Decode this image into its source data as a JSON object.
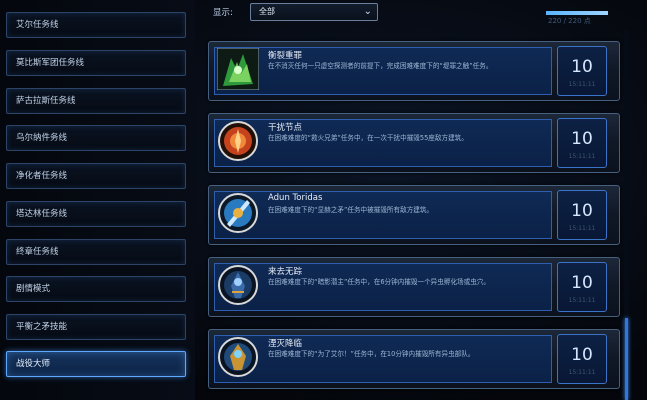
{
  "sidebar": {
    "items": [
      {
        "label": "艾尔任务线",
        "active": false
      },
      {
        "label": "莫比斯军团任务线",
        "active": false
      },
      {
        "label": "萨古拉斯任务线",
        "active": false
      },
      {
        "label": "乌尔纳件务线",
        "active": false
      },
      {
        "label": "净化者任务线",
        "active": false
      },
      {
        "label": "塔达林任务线",
        "active": false
      },
      {
        "label": "终章任务线",
        "active": false
      },
      {
        "label": "剧情模式",
        "active": false
      },
      {
        "label": "平衡之矛技能",
        "active": false
      },
      {
        "label": "战役大师",
        "active": true
      }
    ]
  },
  "filter": {
    "label": "显示:",
    "selected": "全部"
  },
  "progress": {
    "text": "220 / 220 点",
    "fraction": 1.0
  },
  "achievements": [
    {
      "title": "衡裂重罪",
      "desc": "在不消灭任何一只虚空探测者的前提下，完成困难难度下的“堤罪之触”任务。",
      "points": "10",
      "date": "15:11:11",
      "icon": "green-crystal-icon"
    },
    {
      "title": "干扰节点",
      "desc": "在困难难度的“救火兄弟”任务中，在一次干扰中摧毁55座敌方建筑。",
      "points": "10",
      "date": "15:11:11",
      "icon": "red-sigil-icon"
    },
    {
      "title": "Adun Toridas",
      "desc": "在困难难度下的“显赫之矛”任务中被摧毁所有敌方建筑。",
      "points": "10",
      "date": "15:11:11",
      "icon": "blue-blade-icon"
    },
    {
      "title": "来去无踪",
      "desc": "在困难难度下的“暗影潜主”任务中，在6分钟内摧毁一个异虫孵化场或虫穴。",
      "points": "10",
      "date": "15:11:11",
      "icon": "shadow-warrior-icon"
    },
    {
      "title": "湮灭降临",
      "desc": "在困难难度下的“为了艾尔！”任务中，在10分钟内摧毁所有异虫部队。",
      "points": "10",
      "date": "15:11:11",
      "icon": "golden-warrior-icon"
    }
  ],
  "colors": {
    "accent": "#5fa8ff",
    "card_inner": "#0f2a55",
    "background": "#05070d"
  }
}
